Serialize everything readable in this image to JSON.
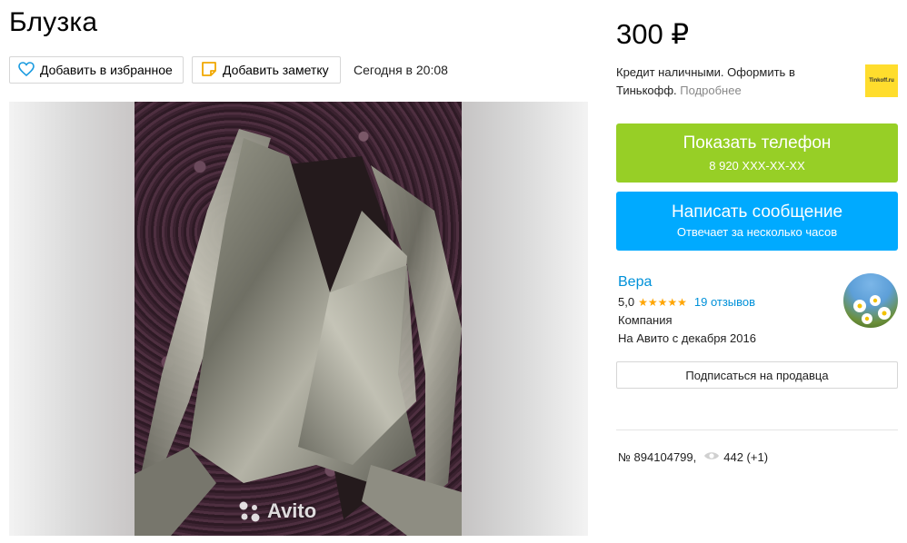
{
  "item": {
    "title": "Блузка",
    "date": "Сегодня в 20:08",
    "price": "300 ₽"
  },
  "actions": {
    "favorite_label": "Добавить в избранное",
    "note_label": "Добавить заметку"
  },
  "gallery": {
    "watermark": "Avito"
  },
  "credit_ad": {
    "text": "Кредит наличными. Оформить в Тинькофф.",
    "more": "Подробнее",
    "logo_text": "Tinkoff.ru"
  },
  "contact": {
    "show_phone_label": "Показать телефон",
    "phone_masked": "8 920 XXX-XX-XX",
    "message_label": "Написать сообщение",
    "message_sub": "Отвечает за несколько часов"
  },
  "seller": {
    "name": "Вера",
    "rating": "5,0",
    "stars": "★★★★★",
    "reviews": "19 отзывов",
    "type": "Компания",
    "since": "На Авито с декабря 2016",
    "subscribe_label": "Подписаться на продавца"
  },
  "meta": {
    "ad_number": "№ 894104799,",
    "views": "442 (+1)"
  },
  "colors": {
    "green_button": "#97cf26",
    "blue_button": "#00aaff",
    "link": "#0091d9",
    "star": "#ffa500",
    "tinkoff_yellow": "#ffdd2d"
  },
  "icons": [
    "heart-icon",
    "note-icon",
    "eye-icon",
    "camera-dots-icon"
  ]
}
